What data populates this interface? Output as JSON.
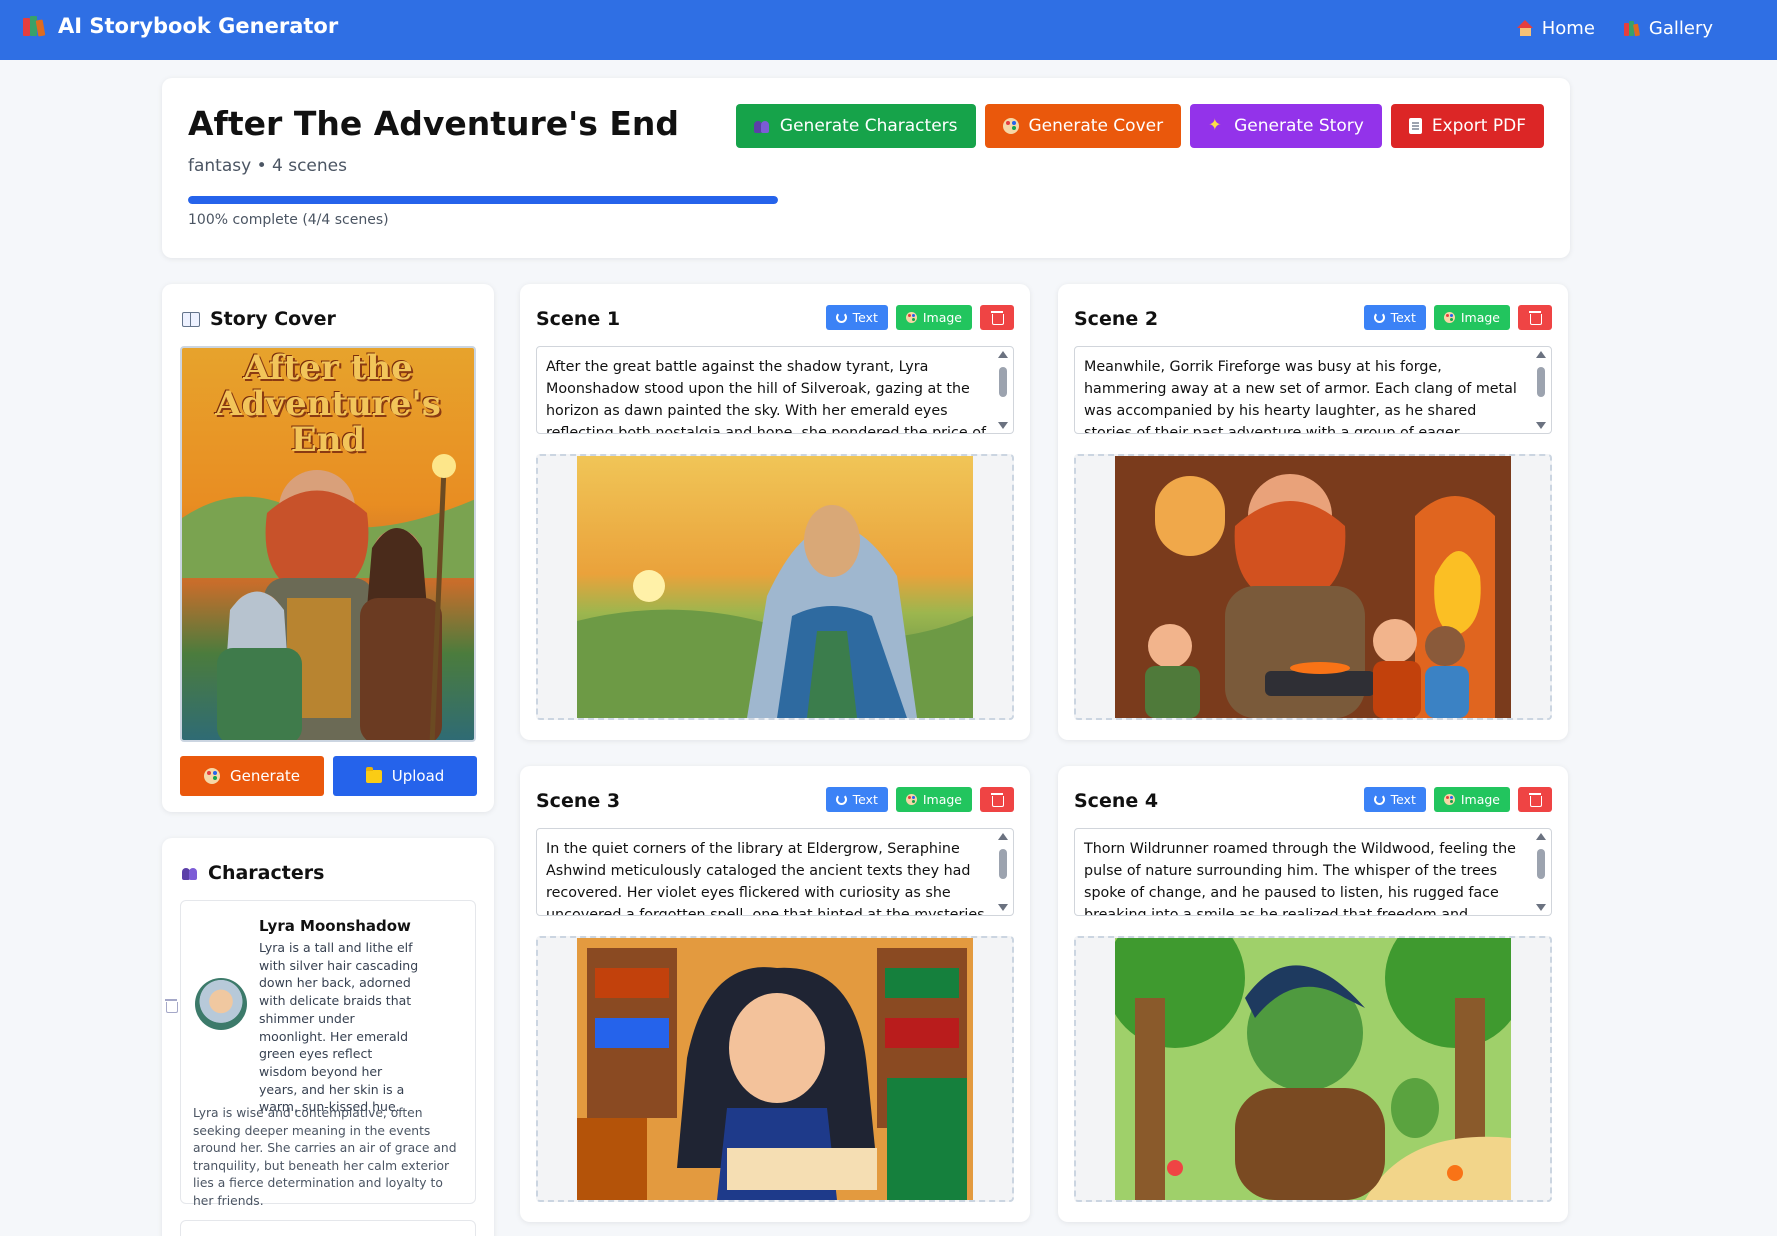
{
  "app": {
    "title": "AI Storybook Generator",
    "nav": [
      {
        "label": "Home",
        "icon": "house-icon"
      },
      {
        "label": "Gallery",
        "icon": "books-icon"
      }
    ]
  },
  "story": {
    "title": "After The Adventure's End",
    "meta": "fantasy • 4 scenes",
    "progress_fraction": 1.0,
    "progress_text": "100% complete (4/4 scenes)"
  },
  "actions": {
    "generate_characters": "Generate Characters",
    "generate_cover": "Generate Cover",
    "generate_story": "Generate Story",
    "export_pdf": "Export PDF"
  },
  "cover": {
    "section_title": "Story Cover",
    "image_title_text": "After the Adventure's End",
    "generate_label": "Generate",
    "upload_label": "Upload"
  },
  "characters": {
    "section_title": "Characters",
    "items": [
      {
        "name": "Lyra Moonshadow",
        "description": "Lyra is a tall and lithe elf with silver hair cascading down her back, adorned with delicate braids that shimmer under moonlight. Her emerald green eyes reflect wisdom beyond her years, and her skin is a warm, sun-kissed hue.",
        "personality": "Lyra is wise and contemplative, often seeking deeper meaning in the events around her. She carries an air of grace and tranquility, but beneath her calm exterior lies a fierce determination and loyalty to her friends."
      }
    ]
  },
  "scene_buttons": {
    "text": "Text",
    "image": "Image"
  },
  "scenes": [
    {
      "title": "Scene 1",
      "text": "After the great battle against the shadow tyrant, Lyra Moonshadow stood upon the hill of Silveroak, gazing at the horizon as dawn painted the sky. With her emerald eyes reflecting both nostalgia and hope, she pondered the price of their victory."
    },
    {
      "title": "Scene 2",
      "text": "Meanwhile, Gorrik Fireforge was busy at his forge, hammering away at a new set of armor. Each clang of metal was accompanied by his hearty laughter, as he shared stories of their past adventure with a group of eager younglings, letting the"
    },
    {
      "title": "Scene 3",
      "text": "In the quiet corners of the library at Eldergrow, Seraphine Ashwind meticulously cataloged the ancient texts they had recovered. Her violet eyes flickered with curiosity as she uncovered a forgotten spell, one that hinted at the mysteries of their next journey she felt"
    },
    {
      "title": "Scene 4",
      "text": "Thorn Wildrunner roamed through the Wildwood, feeling the pulse of nature surrounding him. The whisper of the trees spoke of change, and he paused to listen, his rugged face breaking into a smile as he realized that freedom and adventure awaited just"
    }
  ],
  "colors": {
    "topbar": "#2f6fe4",
    "green": "#16a34a",
    "orange": "#ea580c",
    "purple": "#9333ea",
    "red": "#dc2626",
    "blue": "#2563eb"
  }
}
